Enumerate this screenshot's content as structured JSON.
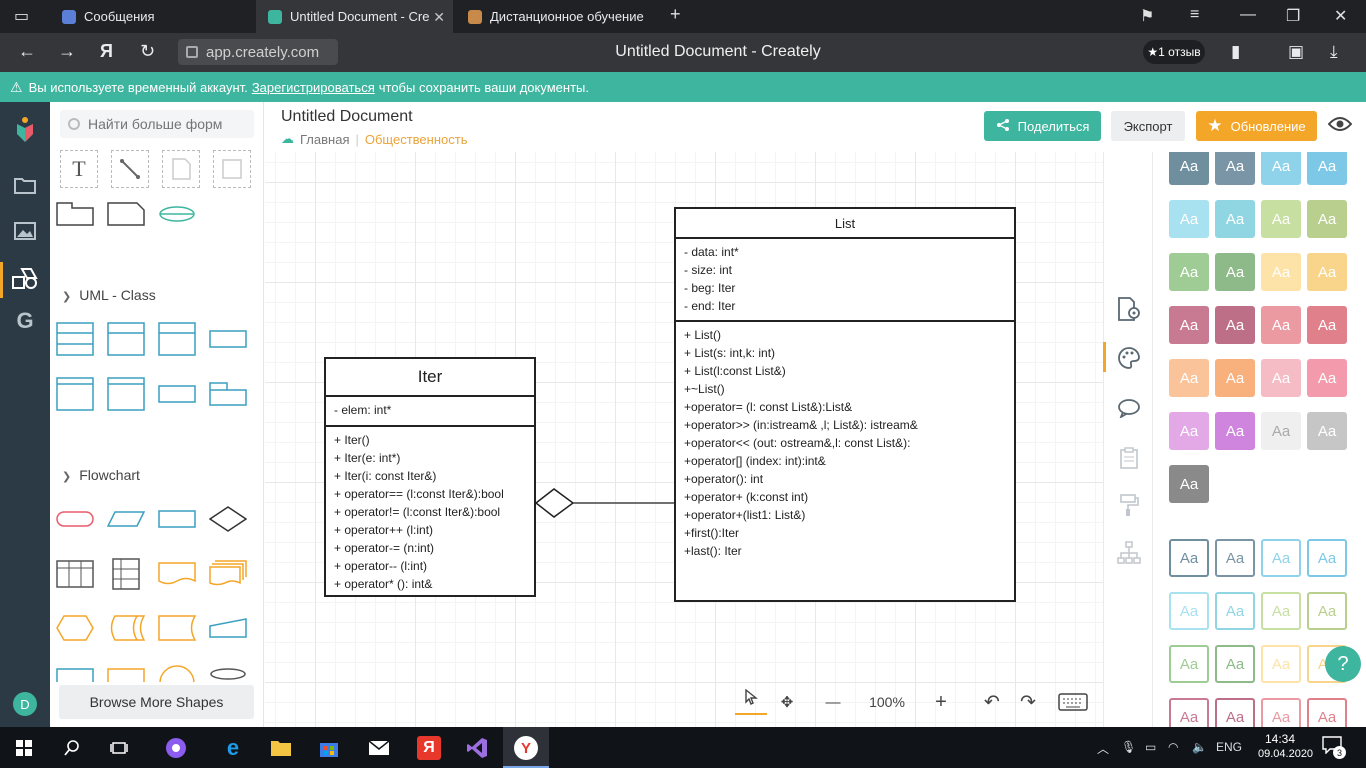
{
  "browser": {
    "tabs": [
      {
        "label": "Сообщения",
        "active": false
      },
      {
        "label": "Untitled Document - Cre",
        "active": true
      },
      {
        "label": "Дистанционное обучение",
        "active": false
      }
    ],
    "url": "app.creately.com",
    "page_title": "Untitled Document - Creately",
    "review_label": "★1 отзыв"
  },
  "notice": {
    "text_before": "Вы используете временный аккаунт.",
    "link": "Зарегистрироваться",
    "text_after": "чтобы сохранить ваши документы."
  },
  "sidebar": {
    "avatar_letter": "D",
    "icons": [
      "creately-logo-icon",
      "folder-icon",
      "image-icon",
      "shapes-icon",
      "google-icon"
    ]
  },
  "shapes_panel": {
    "search_placeholder": "Найти больше форм",
    "sections": [
      "UML - Class",
      "Flowchart"
    ],
    "browse_label": "Browse More Shapes"
  },
  "document": {
    "title": "Untitled Document",
    "breadcrumb_home": "Главная",
    "breadcrumb_public": "Общественность",
    "share_label": "Поделиться",
    "export_label": "Экспорт",
    "upgrade_label": "Обновление"
  },
  "diagram": {
    "iter": {
      "name": "Iter",
      "attributes": [
        "- elem: int*"
      ],
      "methods": [
        "+ Iter()",
        "+ Iter(e: int*)",
        "+ Iter(i: const Iter&)",
        "+ operator== (l:const Iter&):bool",
        "+ operator!= (l:const Iter&):bool",
        "+ operator++ (l:int)",
        "+ operator-= (n:int)",
        "+ operator-- (l:int)",
        "+ operator* (): int&"
      ]
    },
    "list": {
      "name": "List",
      "attributes": [
        "- data: int*",
        "- size: int",
        "- beg: Iter",
        "- end: Iter"
      ],
      "methods": [
        "+ List()",
        "+ List(s: int,k:  int)",
        "+ List(l:const List&)",
        "+~List()",
        "+operator= (l: const List&):List&",
        "+operator>> (in:istream& ,l; List&): istream&",
        "+operator<< (out: ostream&,l: const List&):",
        "+operator[] (index: int):int&",
        "+operator(): int",
        "+operator+ (k:const int)",
        "+operator+(list1: List&)",
        "+first():Iter",
        "+last(): Iter"
      ]
    }
  },
  "zoom": {
    "minus": "—",
    "level": "100%",
    "plus": "+"
  },
  "palette": {
    "swatch_label": "Aa",
    "filled": [
      "#6f8f9f",
      "#7a95a5",
      "#8fd3ea",
      "#7cc8e6",
      "#a8e1ef",
      "#8fd6e2",
      "#c7dfa0",
      "#b9cf8e",
      "#9fcc94",
      "#8dba88",
      "#fde3a7",
      "#f8d58a",
      "#c97a93",
      "#bd6f88",
      "#eb9aa2",
      "#e0808b",
      "#fbc39a",
      "#f8b07d",
      "#f6bcc6",
      "#f39bac",
      "#e3a9e6",
      "#cf85dd",
      "#efefef",
      "#c6c6c6",
      "#8a8a8a"
    ],
    "outline": [
      "#6f8f9f",
      "#7a95a5",
      "#8fd3ea",
      "#7cc8e6",
      "#a8e1ef",
      "#8fd6e2",
      "#c7dfa0",
      "#b9cf8e",
      "#9fcc94",
      "#8dba88",
      "#fde3a7",
      "#f8d58a",
      "#c97a93",
      "#bd6f88",
      "#eb9aa2",
      "#e0808b"
    ]
  },
  "taskbar": {
    "lang": "ENG",
    "time": "14:34",
    "date": "09.04.2020",
    "notifications": "3"
  },
  "colors": {
    "accent": "#3eb59e",
    "upgrade": "#f4a629",
    "sidebar": "#2c3a45"
  }
}
